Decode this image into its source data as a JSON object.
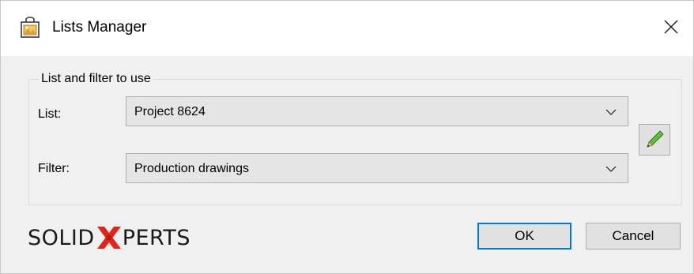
{
  "window": {
    "title": "Lists Manager",
    "close_icon": "close-icon",
    "app_icon": "lists-manager-app-icon"
  },
  "group": {
    "legend": "List and filter to use",
    "list_label": "List:",
    "list_value": "Project 8624",
    "filter_label": "Filter:",
    "filter_value": "Production drawings",
    "edit_icon": "pencil-icon"
  },
  "logo": {
    "left_text": "SOLID",
    "right_text": "PERTS",
    "accent_color": "#e1251b"
  },
  "buttons": {
    "ok_label": "OK",
    "cancel_label": "Cancel"
  },
  "colors": {
    "focus_border": "#0078d7",
    "dialog_bg": "#f0f0f0"
  }
}
